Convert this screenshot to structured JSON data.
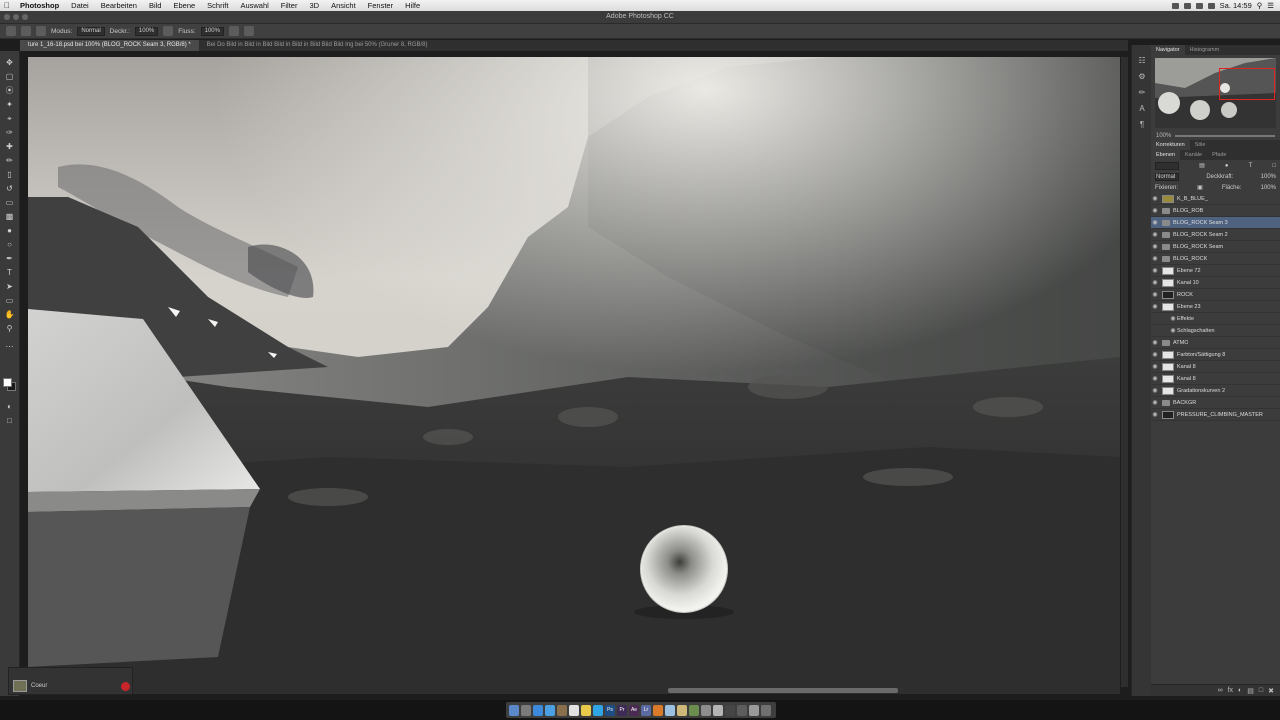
{
  "menubar": {
    "app_name": "Photoshop",
    "menus": [
      "Datei",
      "Bearbeiten",
      "Bild",
      "Ebene",
      "Schrift",
      "Auswahl",
      "Filter",
      "3D",
      "Ansicht",
      "Fenster",
      "Hilfe"
    ],
    "clock": "Sa. 14:59"
  },
  "window": {
    "title": "Adobe Photoshop CC"
  },
  "tabs": [
    {
      "label": "ture 1_16-18.psd bei 100% (BLOG_ROCK Seam 3, RGB/8) *",
      "active": true
    },
    {
      "label": "Bei Do Bild in Bild in Bild Bild in Bild in Bild Bild Bild Ing bei 50% (Gruner 8, RGB/8)",
      "active": false
    }
  ],
  "options_bar": {
    "mode_label": "Modus:",
    "mode_value": "Normal",
    "opacity_label": "Deckr.:",
    "opacity_value": "100%",
    "flow_label": "Fluss:",
    "flow_value": "100%"
  },
  "navigator": {
    "tabs": [
      "Navigator",
      "Histogramm"
    ],
    "zoom": "100%"
  },
  "adjust_tabs": [
    "Korrekturen",
    "Stile"
  ],
  "layers_panel": {
    "tabs": [
      "Ebenen",
      "Kanäle",
      "Pfade"
    ],
    "blend_mode": "Normal",
    "opacity_label": "Deckkraft:",
    "opacity_value": "100%",
    "fill_label": "Fläche:",
    "fill_value": "100%",
    "lock_label": "Fixieren:",
    "layers": [
      {
        "name": "K_B_BLUE_",
        "kind": "gold",
        "selected": false
      },
      {
        "name": "BLOG_ROB",
        "kind": "folder",
        "selected": false
      },
      {
        "name": "BLOG_ROCK Seam 3",
        "kind": "folder",
        "selected": true
      },
      {
        "name": "BLOG_ROCK Seam 2",
        "kind": "folder",
        "selected": false
      },
      {
        "name": "BLOG_ROCK Seam",
        "kind": "folder",
        "selected": false
      },
      {
        "name": "BLOG_ROCK",
        "kind": "folder",
        "selected": false
      },
      {
        "name": "Ebene 72",
        "kind": "thumb",
        "selected": false
      },
      {
        "name": "Kanal 10",
        "kind": "thumb",
        "selected": false
      },
      {
        "name": "ROCK",
        "kind": "dark",
        "selected": false
      },
      {
        "name": "Ebene 23",
        "kind": "thumb",
        "selected": false
      },
      {
        "name": "Effekte",
        "kind": "text",
        "selected": false
      },
      {
        "name": "Schlagschatten",
        "kind": "text",
        "selected": false
      },
      {
        "name": "ATMO",
        "kind": "folder",
        "selected": false
      },
      {
        "name": "Farbton/Sättigung 8",
        "kind": "thumb",
        "selected": false
      },
      {
        "name": "Kanal 8",
        "kind": "thumb",
        "selected": false
      },
      {
        "name": "Kanal 8",
        "kind": "thumb",
        "selected": false
      },
      {
        "name": "Gradationskurven 2",
        "kind": "thumb",
        "selected": false
      },
      {
        "name": "BACKGR",
        "kind": "folder",
        "selected": false
      },
      {
        "name": "PRESSURE_CLIMBING_MASTER",
        "kind": "dark",
        "selected": false
      }
    ]
  },
  "timeline": {
    "label": "Coeur"
  },
  "colors": {
    "ui_dark": "#3c3c3c",
    "selected_layer": "#4f6380",
    "navigator_box": "#e2241f",
    "record": "#c8252b"
  }
}
